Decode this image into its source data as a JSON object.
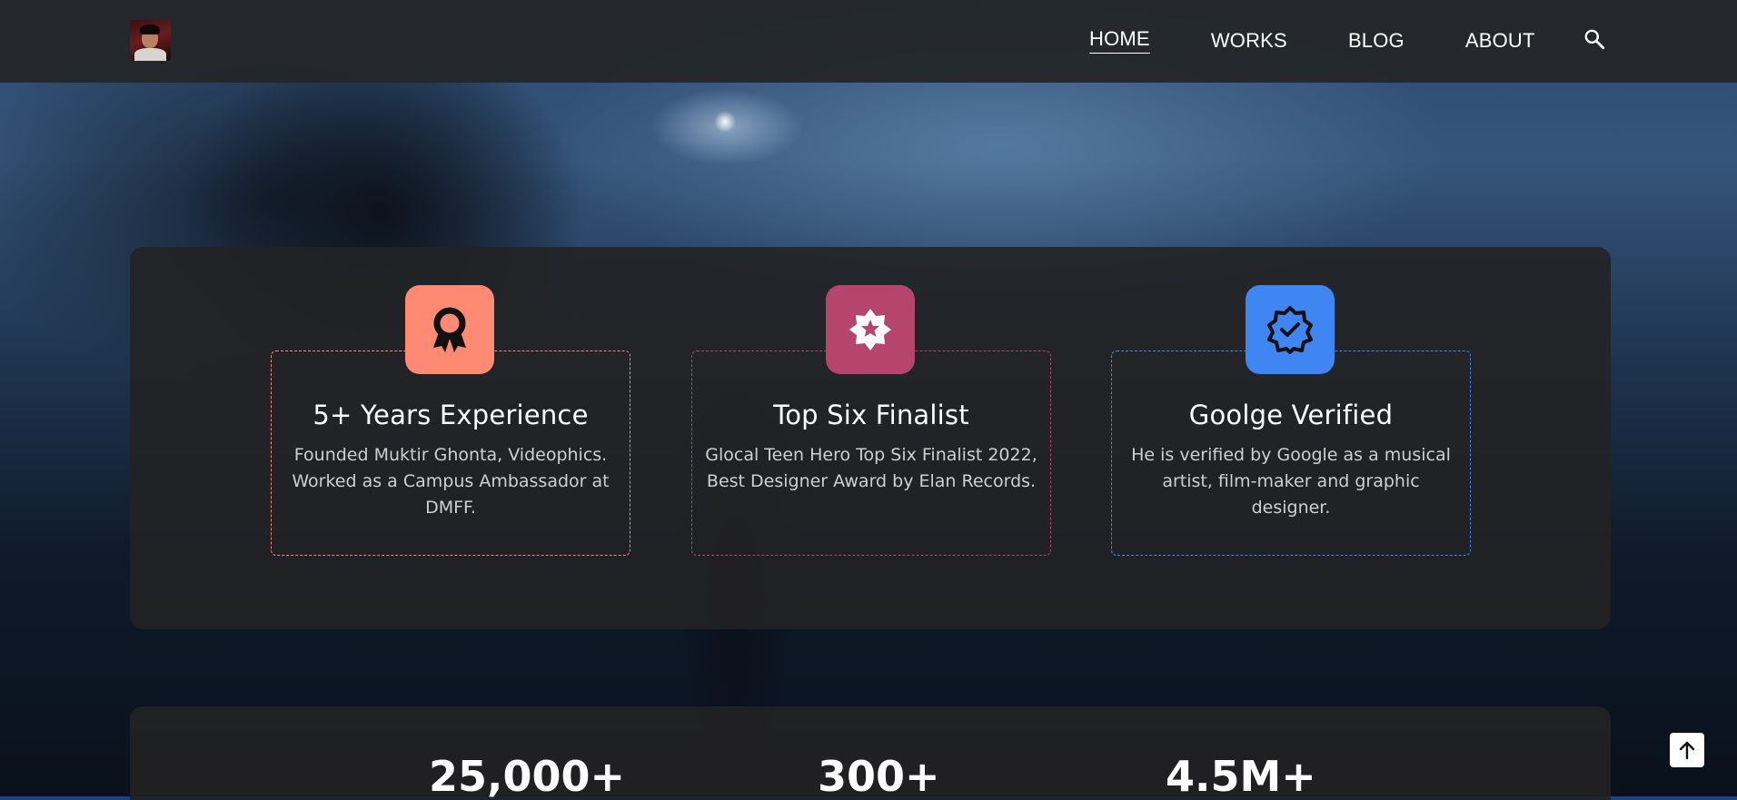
{
  "nav": {
    "items": [
      {
        "label": "HOME",
        "active": true
      },
      {
        "label": "WORKS",
        "active": false
      },
      {
        "label": "BLOG",
        "active": false
      },
      {
        "label": "ABOUT",
        "active": false
      }
    ],
    "search_icon": "search-icon"
  },
  "logo": {
    "icon": "profile-avatar"
  },
  "achievements": [
    {
      "title": "5+ Years Experience",
      "description": "Founded Muktir Ghonta, Videophics. Worked as a Campus Ambassador at DMFF.",
      "icon": "award-ribbon-icon",
      "color": "#ff8a73"
    },
    {
      "title": "Top Six Finalist",
      "description": "Glocal Teen Hero Top Six Finalist 2022, Best Designer Award by Elan Records.",
      "icon": "star-badge-icon",
      "color": "#b5456a"
    },
    {
      "title": "Goolge Verified",
      "description": "He is verified by Google as a musical artist, film-maker and graphic designer.",
      "icon": "verified-badge-icon",
      "color": "#3f86f2"
    }
  ],
  "stats": [
    {
      "value": "25,000+"
    },
    {
      "value": "300+"
    },
    {
      "value": "4.5M+"
    }
  ],
  "back_to_top_icon": "arrow-up-icon"
}
